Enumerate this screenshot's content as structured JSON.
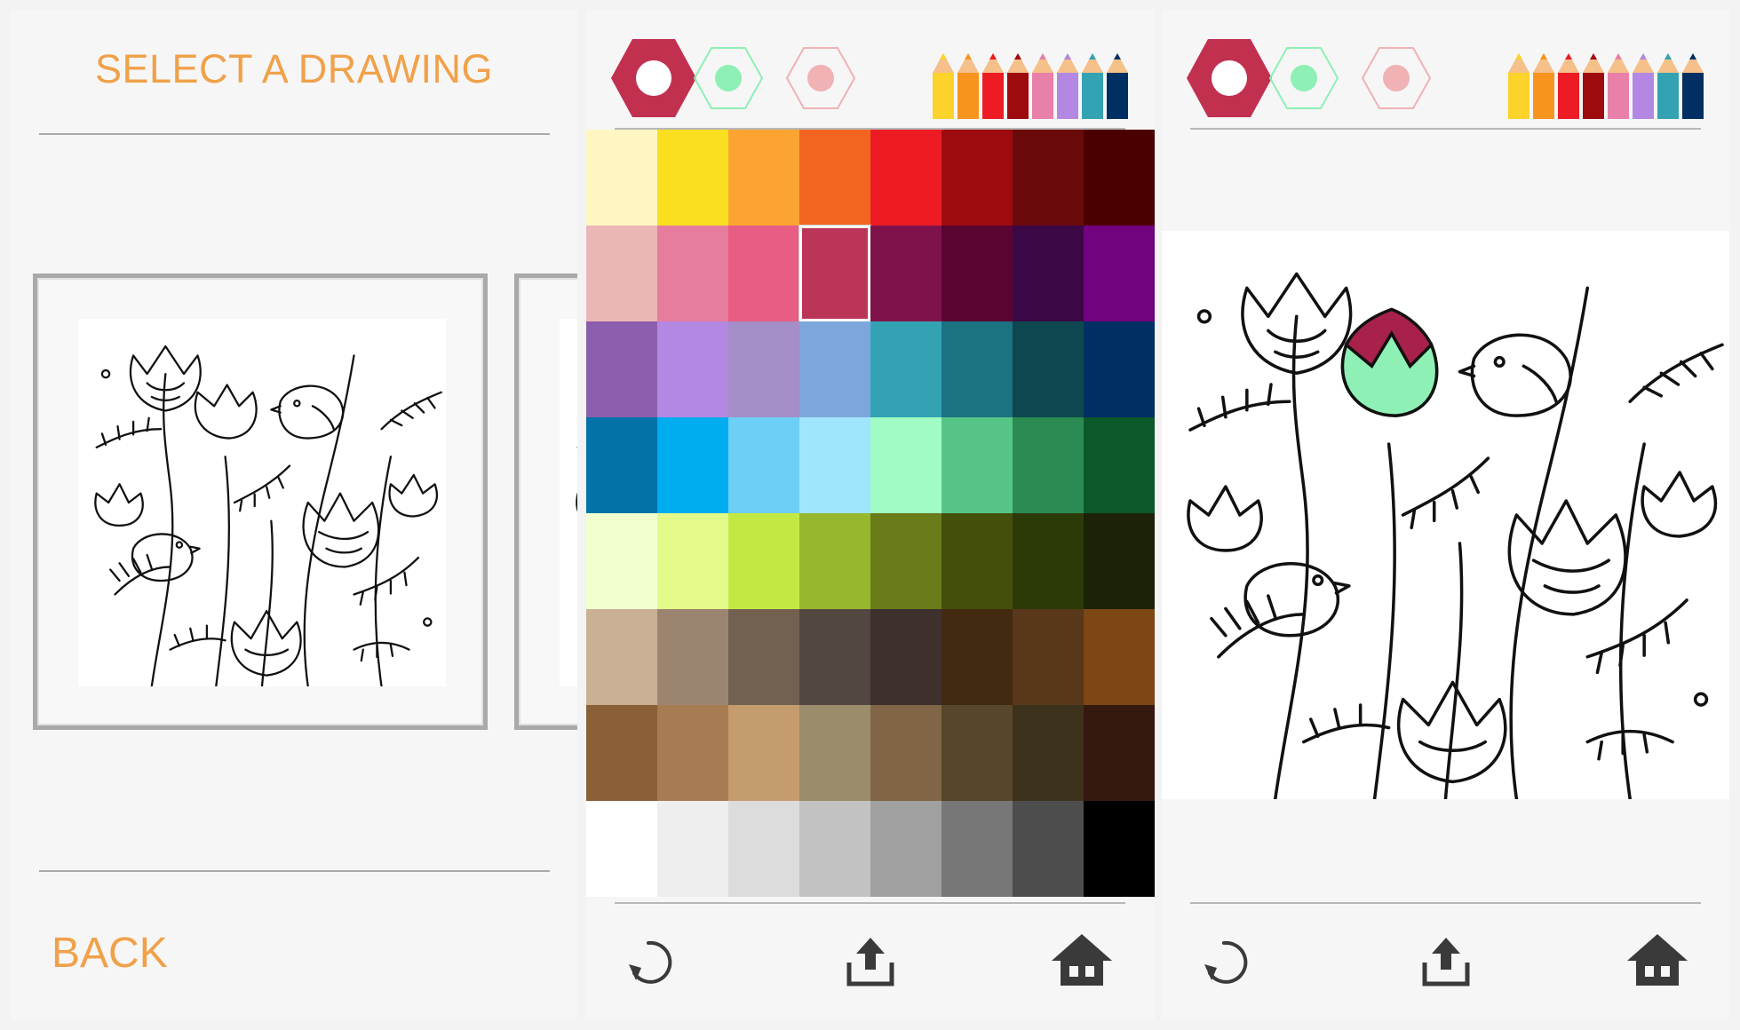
{
  "select_screen": {
    "title": "SELECT A DRAWING",
    "back_label": "BACK"
  },
  "toolbar": {
    "brush_sizes": [
      "large-brush",
      "medium-brush",
      "small-brush"
    ],
    "pencils_icon": "colored-pencils-icon"
  },
  "palette": {
    "rows": [
      [
        "#fff6c2",
        "#f9df20",
        "#fca431",
        "#f26521",
        "#ed1c24",
        "#9e0b0f",
        "#6b0a0b",
        "#4a0000"
      ],
      [
        "#ebb6b6",
        "#e67d9c",
        "#e75d84",
        "#bb3558",
        "#7f124b",
        "#5a0431",
        "#3b0845",
        "#71037e"
      ],
      [
        "#8b5fad",
        "#b388e2",
        "#a48ec7",
        "#7da7dc",
        "#33a3b4",
        "#1b7280",
        "#0f4750",
        "#002f63"
      ],
      [
        "#0372a8",
        "#00aeef",
        "#6dcff6",
        "#9fe5fd",
        "#a0fbc4",
        "#56c485",
        "#2b8b52",
        "#0b582a"
      ],
      [
        "#f1ffce",
        "#e3fa8a",
        "#c2e943",
        "#97b72e",
        "#6a7b19",
        "#444f0c",
        "#2c3a07",
        "#1b2208"
      ],
      [
        "#c9b094",
        "#9c8570",
        "#726150",
        "#534841",
        "#3d302d",
        "#412a10",
        "#58371a",
        "#7c4714"
      ],
      [
        "#8b6037",
        "#a87c53",
        "#c59c6e",
        "#9b8c6c",
        "#806646",
        "#57462a",
        "#3c321c",
        "#35180f"
      ],
      [
        "#ffffff",
        "#eeeeee",
        "#dcdcdc",
        "#c2c2c2",
        "#a0a0a0",
        "#777777",
        "#4d4d4d",
        "#000000"
      ]
    ],
    "selected_index": [
      1,
      3
    ]
  },
  "colors": {
    "accent": "#f0a14a",
    "brush_large": "#c2304f",
    "brush_medium": "#8ef0b4",
    "brush_small": "#f0b2b4"
  },
  "bottom_tools": {
    "undo_icon": "undo-icon",
    "share_icon": "share-icon",
    "home_icon": "home-icon"
  }
}
